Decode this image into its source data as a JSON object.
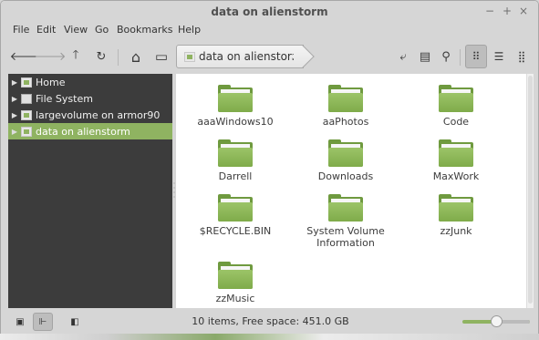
{
  "window": {
    "title": "data on alienstorm",
    "controls": {
      "minimize": "−",
      "maximize": "+",
      "close": "×"
    }
  },
  "menu": [
    "File",
    "Edit",
    "View",
    "Go",
    "Bookmarks",
    "Help"
  ],
  "toolbar": {
    "buttons": [
      {
        "name": "back-button",
        "icon": "back-arrow-icon",
        "glyph": "🡐"
      },
      {
        "name": "forward-button",
        "icon": "forward-arrow-icon",
        "glyph": "🡒"
      },
      {
        "name": "up-button",
        "icon": "up-arrow-icon",
        "glyph": "🡑"
      },
      {
        "name": "reload-button",
        "icon": "reload-icon",
        "glyph": "↻"
      },
      {
        "name": "home-button",
        "icon": "home-icon",
        "glyph": "⌂"
      },
      {
        "name": "computer-button",
        "icon": "computer-icon",
        "glyph": "▭"
      }
    ],
    "path_label": "data on alienstorm",
    "right_tools": [
      {
        "name": "toggle-location-button",
        "icon": "location-icon",
        "glyph": "⤶"
      },
      {
        "name": "open-terminal-button",
        "icon": "terminal-icon",
        "glyph": "▤"
      },
      {
        "name": "search-button",
        "icon": "search-icon",
        "glyph": "⚲"
      }
    ],
    "views": [
      {
        "name": "icon-view-button",
        "icon": "grid-icon",
        "glyph": "⠿",
        "active": true
      },
      {
        "name": "list-view-button",
        "icon": "list-icon",
        "glyph": "☰",
        "active": false
      },
      {
        "name": "compact-view-button",
        "icon": "compact-icon",
        "glyph": "⣿",
        "active": false
      }
    ]
  },
  "sidebar": {
    "items": [
      {
        "label": "Home",
        "icon": "home-folder-icon",
        "selected": false
      },
      {
        "label": "File System",
        "icon": "drive-icon",
        "selected": false
      },
      {
        "label": "largevolume on armor90",
        "icon": "network-folder-icon",
        "selected": false
      },
      {
        "label": "data on alienstorm",
        "icon": "network-folder-icon",
        "selected": true
      }
    ]
  },
  "files": [
    {
      "name": "aaaWindows10"
    },
    {
      "name": "aaPhotos"
    },
    {
      "name": "Code"
    },
    {
      "name": "Darrell"
    },
    {
      "name": "Downloads"
    },
    {
      "name": "MaxWork"
    },
    {
      "name": "$RECYCLE.BIN"
    },
    {
      "name": "System Volume\nInformation"
    },
    {
      "name": "zzJunk"
    },
    {
      "name": "zzMusic"
    }
  ],
  "statusbar": {
    "text": "10 items, Free space: 451.0 GB",
    "zoom_level": 0.5,
    "buttons": [
      {
        "name": "show-places-button",
        "icon": "places-icon",
        "glyph": "▣",
        "active": false
      },
      {
        "name": "show-tree-button",
        "icon": "tree-icon",
        "glyph": "⊩",
        "active": true
      },
      {
        "name": "hide-sidebar-button",
        "icon": "sidebar-toggle-icon",
        "glyph": "◧",
        "active": false
      }
    ]
  },
  "colors": {
    "accent": "#8fb361",
    "sidebar_bg": "#3c3c3c",
    "folder_green": "#7fab4a"
  }
}
